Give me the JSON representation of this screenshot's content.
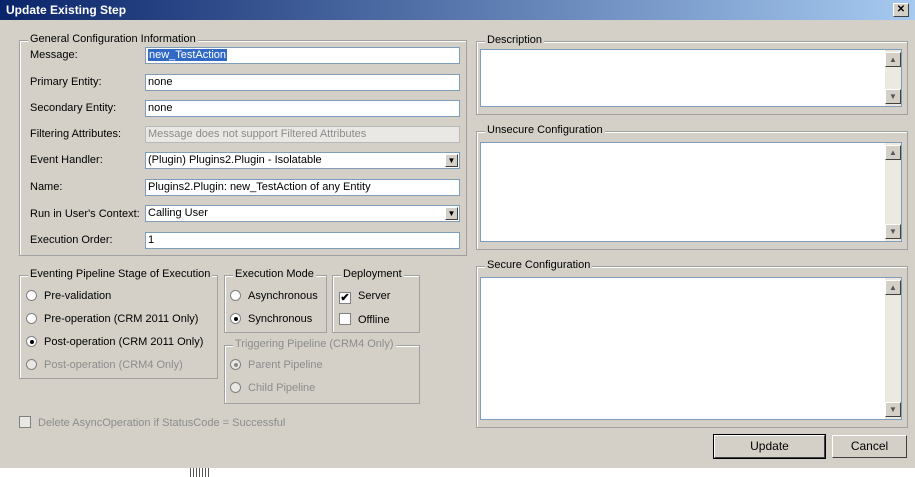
{
  "window": {
    "title": "Update Existing Step",
    "close_glyph": "✕"
  },
  "general": {
    "legend": "General Configuration Information",
    "message_label": "Message:",
    "message_value": "new_TestAction",
    "primary_label": "Primary Entity:",
    "primary_value": "none",
    "secondary_label": "Secondary Entity:",
    "secondary_value": "none",
    "filtering_label": "Filtering Attributes:",
    "filtering_value": "Message does not support Filtered Attributes",
    "handler_label": "Event Handler:",
    "handler_value": "(Plugin) Plugins2.Plugin - Isolatable",
    "name_label": "Name:",
    "name_value": "Plugins2.Plugin: new_TestAction of  any Entity",
    "context_label": "Run in User's Context:",
    "context_value": "Calling User",
    "order_label": "Execution Order:",
    "order_value": "1"
  },
  "stage": {
    "legend": "Eventing Pipeline Stage of Execution",
    "options": [
      {
        "label": "Pre-validation",
        "checked": false,
        "disabled": false
      },
      {
        "label": "Pre-operation (CRM 2011 Only)",
        "checked": false,
        "disabled": false
      },
      {
        "label": "Post-operation (CRM 2011 Only)",
        "checked": true,
        "disabled": false
      },
      {
        "label": "Post-operation (CRM4 Only)",
        "checked": false,
        "disabled": true
      }
    ]
  },
  "mode": {
    "legend": "Execution Mode",
    "options": [
      {
        "label": "Asynchronous",
        "checked": false
      },
      {
        "label": "Synchronous",
        "checked": true
      }
    ]
  },
  "deployment": {
    "legend": "Deployment",
    "options": [
      {
        "label": "Server",
        "checked": true
      },
      {
        "label": "Offline",
        "checked": false
      }
    ]
  },
  "triggering": {
    "legend": "Triggering Pipeline (CRM4 Only)",
    "options": [
      {
        "label": "Parent Pipeline",
        "checked": true
      },
      {
        "label": "Child Pipeline",
        "checked": false
      }
    ]
  },
  "delete_async": {
    "label": "Delete AsyncOperation if StatusCode = Successful",
    "checked": false
  },
  "description": {
    "legend": "Description",
    "value": ""
  },
  "unsecure": {
    "legend": "Unsecure Configuration",
    "value": ""
  },
  "secure": {
    "legend": "Secure Configuration",
    "value": ""
  },
  "buttons": {
    "update": "Update",
    "cancel": "Cancel"
  },
  "icons": {
    "dropdown": "▼",
    "scroll_up": "▲",
    "scroll_down": "▼",
    "check": "✔"
  }
}
